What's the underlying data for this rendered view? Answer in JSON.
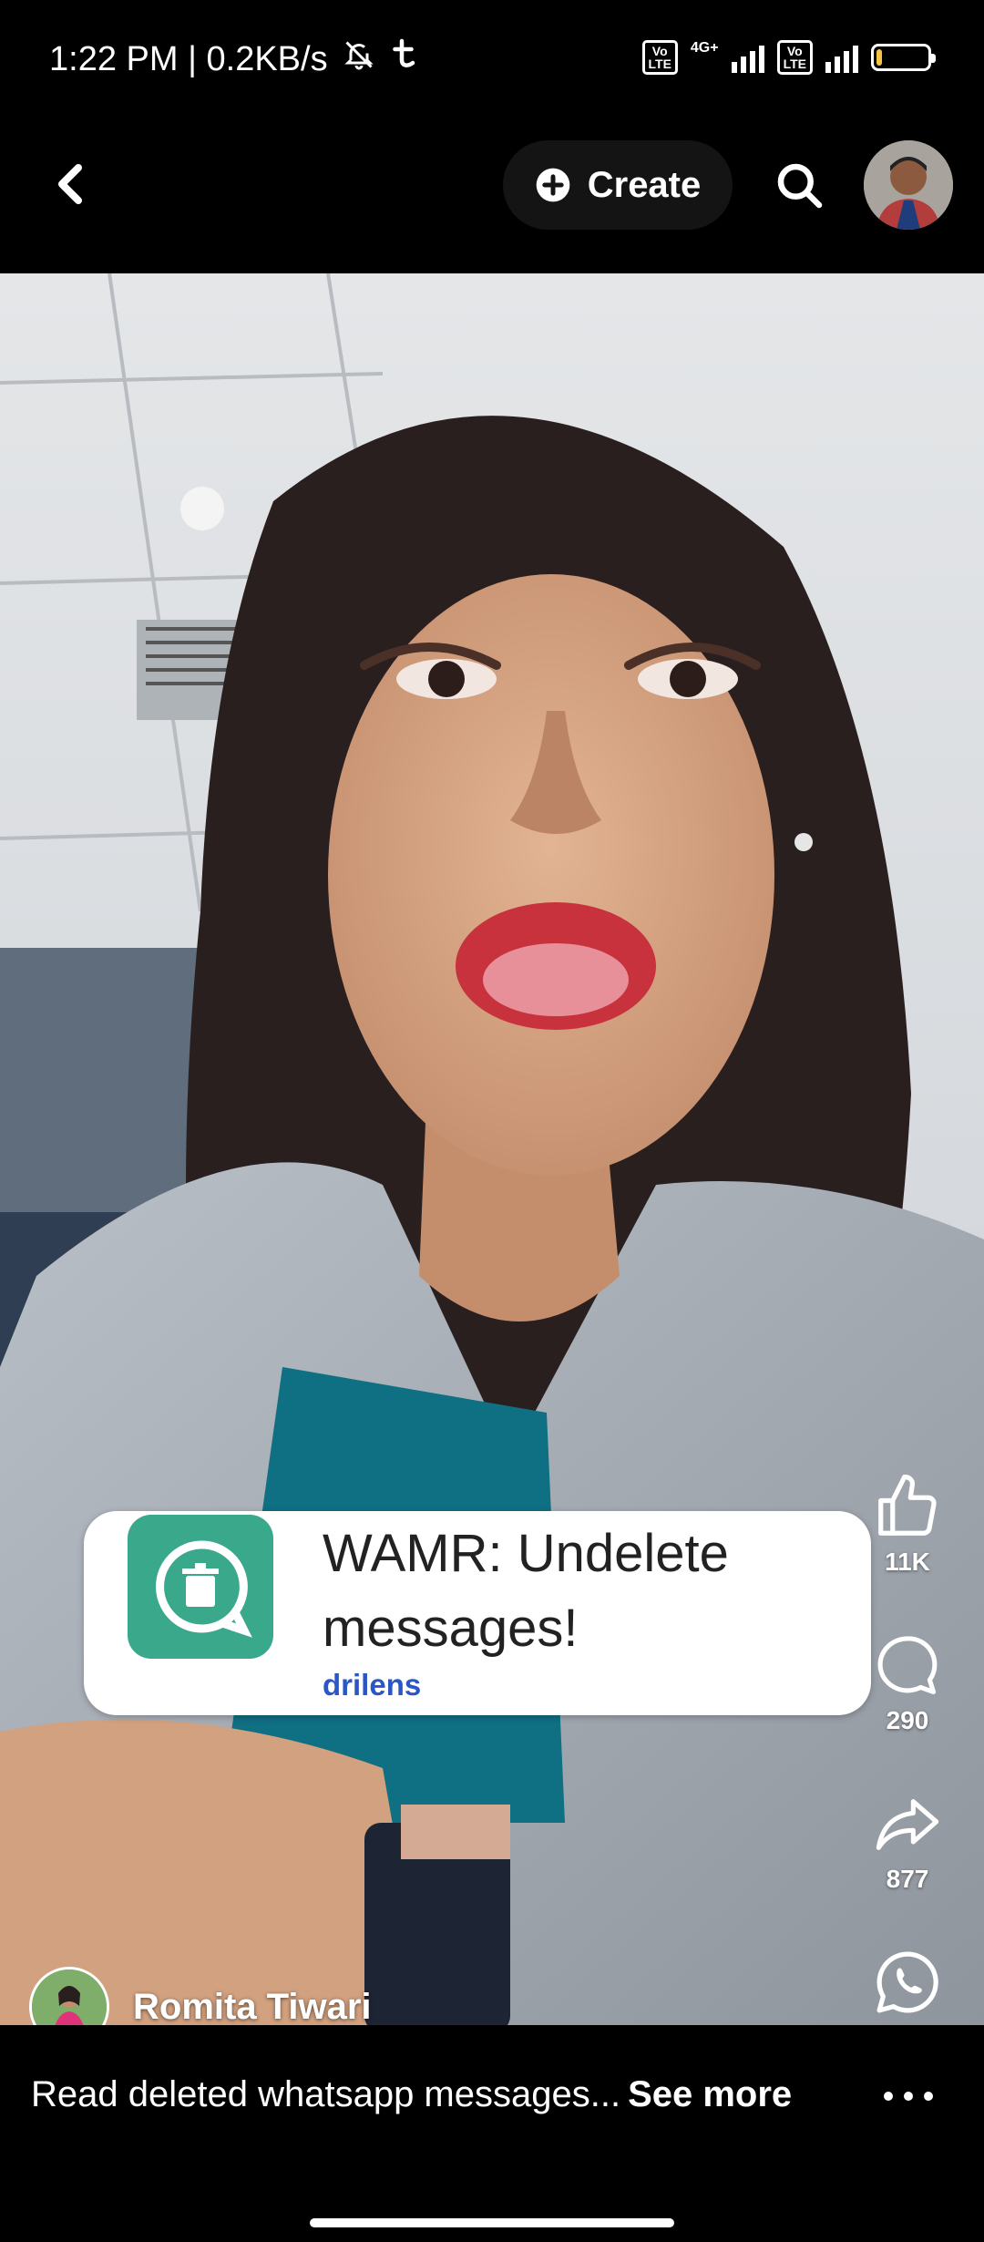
{
  "status_bar": {
    "time_speed": "1:22 PM | 0.2KB/s",
    "network_type": "4G+",
    "volte_label": "Vo\nLTE",
    "battery_level": "11",
    "battery_fraction": 0.11
  },
  "top_nav": {
    "create_label": "Create",
    "icons": {
      "back": "chevron-left-icon",
      "create": "plus-circle-icon",
      "search": "search-icon"
    }
  },
  "video": {
    "overlay_card": {
      "title": "WAMR: Undelete messages!",
      "developer": "drilens",
      "icon": "trash-chat-bubble-icon",
      "accent": "#3aa88a"
    }
  },
  "actions": {
    "like": {
      "icon": "thumbs-up-icon",
      "count": "11K"
    },
    "comment": {
      "icon": "comment-bubble-icon",
      "count": "290"
    },
    "share": {
      "icon": "share-arrow-icon",
      "count": "877"
    },
    "whatsapp": {
      "icon": "whatsapp-icon"
    }
  },
  "author": {
    "name": "Romita Tiwari"
  },
  "caption": {
    "text": "Read deleted whatsapp messages...",
    "see_more": "See more"
  },
  "more_icon": "more-horizontal-icon"
}
